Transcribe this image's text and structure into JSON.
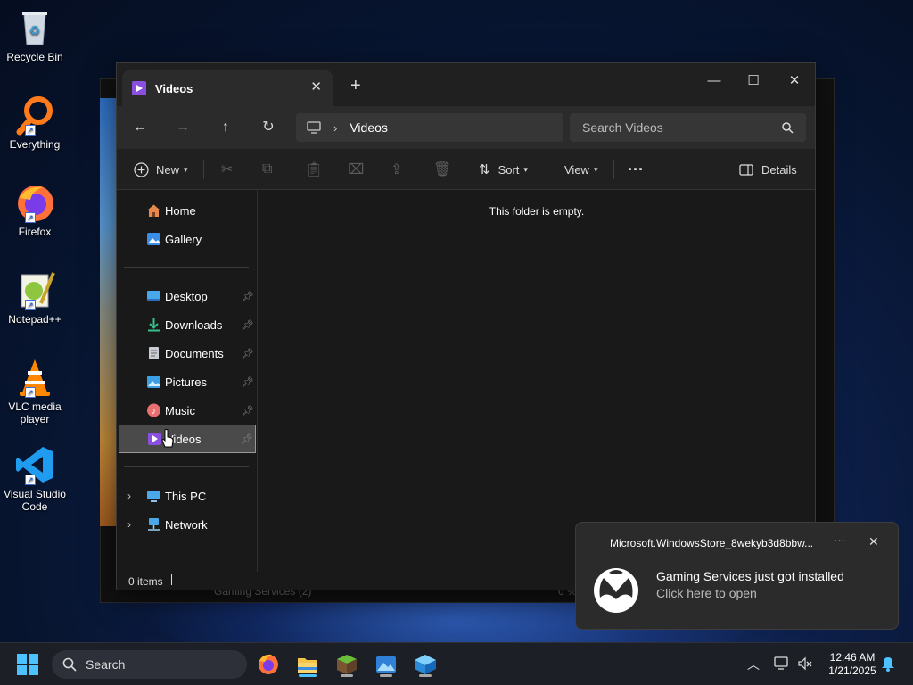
{
  "desktop": {
    "icons": [
      {
        "label": "Recycle Bin"
      },
      {
        "label": "Everything"
      },
      {
        "label": "Firefox"
      },
      {
        "label": "Notepad++"
      },
      {
        "label": "VLC media player"
      },
      {
        "label": "Visual Studio Code"
      }
    ]
  },
  "background_window": {
    "row_text": "Gaming Services (2)",
    "percent": "0 %"
  },
  "explorer": {
    "tab_title": "Videos",
    "address": {
      "location": "Videos"
    },
    "search": {
      "placeholder": "Search Videos"
    },
    "toolbar": {
      "new_label": "New",
      "sort_label": "Sort",
      "view_label": "View",
      "more_label": "···",
      "details_label": "Details"
    },
    "sidebar": {
      "top": [
        "Home",
        "Gallery"
      ],
      "quick_access": [
        "Desktop",
        "Downloads",
        "Documents",
        "Pictures",
        "Music",
        "Videos"
      ],
      "bottom": [
        "This PC",
        "Network"
      ]
    },
    "content": {
      "empty_message": "This folder is empty."
    },
    "status": {
      "item_count": "0 items"
    }
  },
  "toast": {
    "app_name": "Microsoft.WindowsStore_8wekyb3d8bbw...",
    "more_label": "···",
    "title": "Gaming Services just got installed",
    "subtitle": "Click here to open"
  },
  "taskbar": {
    "search_label": "Search",
    "time": "12:46 AM",
    "date": "1/21/2025"
  },
  "colors": {
    "accent": "#4cc2ff",
    "selection": "#4a4a4a",
    "window_bg": "#191919"
  }
}
